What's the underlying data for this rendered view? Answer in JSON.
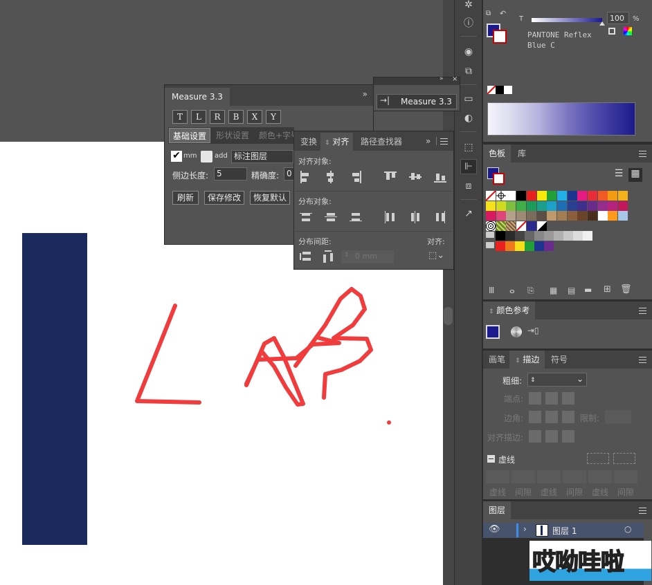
{
  "colors": {
    "accent_blue": "#1a2a5c",
    "ink_red": "#f03c3c",
    "swatch_blue": "#1a1a8c"
  },
  "measure_panel": {
    "tab": "Measure 3.3",
    "expand_label": "»",
    "letter_buttons": [
      "T",
      "L",
      "R",
      "B",
      "X",
      "Y"
    ],
    "subtabs": [
      "基础设置",
      "形状设置",
      "颜色+字号"
    ],
    "mm_label": "mm",
    "add_label": "add",
    "layer_input": "标注图层",
    "side_length_label": "侧边长度:",
    "side_length_value": "5",
    "precision_label": "精确度:",
    "precision_value": "0",
    "buttons": [
      "刷新",
      "保存修改",
      "恢复默认"
    ]
  },
  "measure_mini": {
    "label": "Measure 3.3",
    "dbl_arrow": "»",
    "close": "×"
  },
  "align_panel": {
    "tabs": [
      "变换",
      "对齐",
      "路径查找器"
    ],
    "expand_label": "»",
    "align_objects_label": "对齐对象:",
    "distribute_objects_label": "分布对象:",
    "distribute_spacing_label": "分布间距:",
    "align_to_label": "对齐:",
    "spacing_value": "0 mm"
  },
  "color_panel": {
    "tint_letter": "T",
    "tint_value": "100",
    "percent": "%",
    "color_name_line1": "PANTONE Reflex",
    "color_name_line2": "Blue C"
  },
  "swatches_panel": {
    "tabs": [
      "色板",
      "库"
    ]
  },
  "color_guide_panel": {
    "tab": "颜色参考"
  },
  "stroke_panel": {
    "tabs": [
      "画笔",
      "描边",
      "符号"
    ],
    "weight_label": "粗细:",
    "cap_label": "端点:",
    "corner_label": "边角:",
    "limit_label": "限制:",
    "align_stroke_label": "对齐描边:",
    "dashed_label": "虚线",
    "dash_labels": [
      "虚线",
      "间隙",
      "虚线",
      "间隙",
      "虚线",
      "间隙"
    ]
  },
  "layers_panel": {
    "tab": "图层",
    "layer_name": "图层 1"
  },
  "watermark": {
    "text": "哎呦哇啦"
  }
}
